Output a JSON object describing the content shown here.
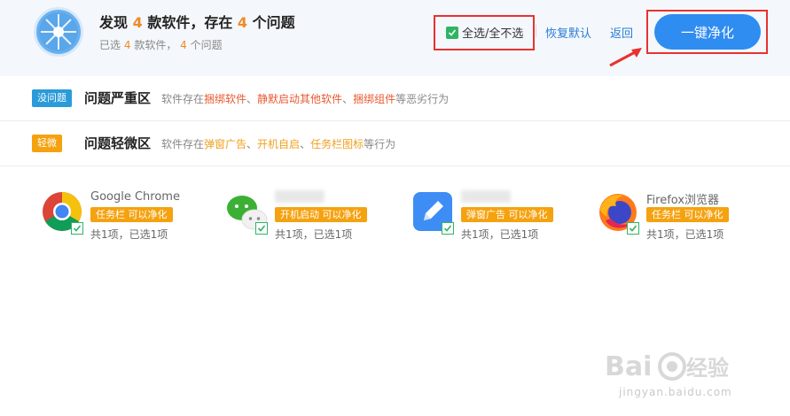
{
  "header": {
    "title_prefix": "发现",
    "title_count": "4",
    "title_mid": "款软件，存在",
    "title_issue_count": "4",
    "title_suffix": "个问题",
    "subtitle_prefix": "已选",
    "subtitle_count": "4",
    "subtitle_mid": "款软件，",
    "subtitle_issue_count": "4",
    "subtitle_suffix": "个问题"
  },
  "toolbar": {
    "select_all_label": "全选/全不选",
    "restore_label": "恢复默认",
    "back_label": "返回",
    "primary_label": "一键净化"
  },
  "sections": [
    {
      "badge": "没问题",
      "badge_color": "#2a9bd8",
      "title": "问题严重区",
      "desc_prefix": "软件存在",
      "desc_items": [
        "捆绑软件",
        "静默启动其他软件",
        "捆绑组件"
      ],
      "desc_sep": "、",
      "desc_suffix": "等恶劣行为"
    },
    {
      "badge": "轻微",
      "badge_color": "#f5a210",
      "title": "问题轻微区",
      "desc_prefix": "软件存在",
      "desc_items": [
        "弹窗广告",
        "开机自启",
        "任务栏图标"
      ],
      "desc_sep": "、",
      "desc_suffix": "等行为"
    }
  ],
  "apps": [
    {
      "name": "Google Chrome",
      "icon": "chrome-icon",
      "tag": "任务栏 可以净化",
      "count": "共1项，已选1项"
    },
    {
      "name": "",
      "icon": "wechat-icon",
      "tag": "开机启动 可以净化",
      "count": "共1项，已选1项"
    },
    {
      "name": "",
      "icon": "notes-icon",
      "tag": "弹窗广告 可以净化",
      "count": "共1项，已选1项"
    },
    {
      "name": "Firefox浏览器",
      "icon": "firefox-icon",
      "tag": "任务栏 可以净化",
      "count": "共1项，已选1项"
    }
  ],
  "watermark": {
    "url": "jingyan.baidu.com"
  },
  "colors": {
    "accent_blue": "#2f8cf1",
    "highlight_orange": "#f08a24",
    "check_green": "#2fb463",
    "annotation_red": "#e8322e"
  }
}
